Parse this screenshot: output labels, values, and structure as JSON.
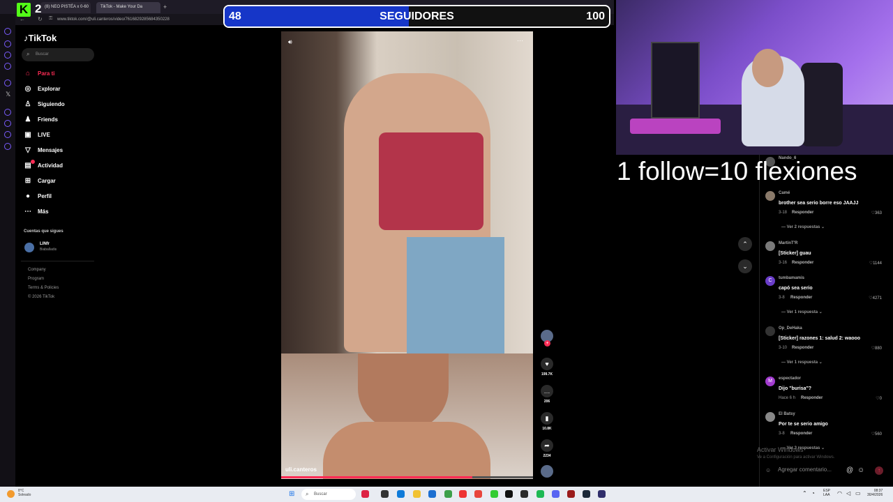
{
  "browser": {
    "tabs": [
      {
        "label": "(8) NEO PISTÉA x 0-60"
      },
      {
        "label": "TikTok - Make Your Da"
      }
    ],
    "new_tab": "+",
    "url": "www.tiktok.com/@uli.canteros/video/7616829285684350228"
  },
  "kick": {
    "logo": "K",
    "number": "2"
  },
  "sidebar": {
    "brand": "TikTok",
    "search_placeholder": "Buscar",
    "items": [
      {
        "label": "Para ti",
        "icon": "home-icon",
        "glyph": "⌂"
      },
      {
        "label": "Explorar",
        "icon": "compass-icon",
        "glyph": "◎"
      },
      {
        "label": "Siguiendo",
        "icon": "following-icon",
        "glyph": "♙"
      },
      {
        "label": "Friends",
        "icon": "friends-icon",
        "glyph": "♟"
      },
      {
        "label": "LIVE",
        "icon": "live-icon",
        "glyph": "▣"
      },
      {
        "label": "Mensajes",
        "icon": "messages-icon",
        "glyph": "▽"
      },
      {
        "label": "Actividad",
        "icon": "activity-icon",
        "glyph": "▤"
      },
      {
        "label": "Cargar",
        "icon": "upload-icon",
        "glyph": "⊞"
      },
      {
        "label": "Perfil",
        "icon": "profile-icon",
        "glyph": "●"
      },
      {
        "label": "Más",
        "icon": "more-icon",
        "glyph": "⋯"
      }
    ],
    "following_heading": "Cuentas que sigues",
    "account": {
      "name": "LINfr",
      "sub": "Biaballadis"
    },
    "footer": [
      "Company",
      "Program",
      "Terms & Policies",
      "© 2026 TikTok"
    ]
  },
  "video": {
    "username": "uli.canteros",
    "progress": 0.76
  },
  "actions": {
    "likes": "199.7K",
    "comments": "206",
    "saves": "10.8K",
    "shares": "2234"
  },
  "goal": {
    "current": "48",
    "label": "SEGUIDORES",
    "max": "100",
    "fill_ratio": 0.48,
    "color": "#1636c8"
  },
  "overlay_text": "1 follow=10 flexiones",
  "comments": [
    {
      "user": "Nando_6",
      "text": "",
      "meta": "",
      "likes": ""
    },
    {
      "user": "Camé",
      "text": "brother sea serio borre eso JAAJJ",
      "meta": "3-18",
      "reply": "Responder",
      "likes": "363",
      "more": "Ver 2 respuestas"
    },
    {
      "user": "MartinT'R",
      "text": "[Sticker] guau",
      "meta": "3-16",
      "reply": "Responder",
      "likes": "1144"
    },
    {
      "user": "tumbamamis",
      "text": "capó sea serio",
      "meta": "3-8",
      "reply": "Responder",
      "likes": "4271",
      "more": "Ver 1 respuesta",
      "avatar_letter": "C"
    },
    {
      "user": "Op_DeHaka",
      "text": "[Sticker] razones 1: salud 2: waooo",
      "meta": "3-10",
      "reply": "Responder",
      "likes": "880",
      "more": "Ver 1 respuesta"
    },
    {
      "user": "espectador",
      "text": "Dijo \"burisa\"?",
      "meta": "Hace 6 h",
      "reply": "Responder",
      "likes": "0",
      "avatar_letter": "M"
    },
    {
      "user": "El Batsy",
      "text": "Por te se serio amigo",
      "meta": "3-8",
      "reply": "Responder",
      "likes": "560",
      "more": "Ver 3 respuestas"
    }
  ],
  "comment_input_placeholder": "Agregar comentario...",
  "windows_notice": {
    "title": "Activar Windows",
    "sub": "Ve a Configuración para activar Windows."
  },
  "taskbar": {
    "weather_temp": "8°C",
    "weather_desc": "Soleado",
    "search": "Buscar",
    "lang_1": "ESP",
    "lang_2": "LAA",
    "time": "08:37",
    "date": "30/4/2026"
  }
}
